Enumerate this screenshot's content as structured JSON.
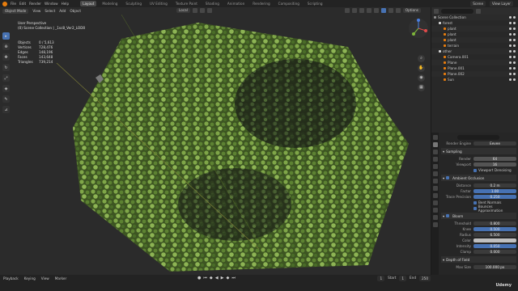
{
  "menu": [
    "File",
    "Edit",
    "Render",
    "Window",
    "Help"
  ],
  "workspaces": [
    "Layout",
    "Modeling",
    "Sculpting",
    "UV Editing",
    "Texture Paint",
    "Shading",
    "Animation",
    "Rendering",
    "Compositing",
    "Scripting"
  ],
  "active_workspace": "Layout",
  "scene_name": "Scene",
  "view_layer": "View Layer",
  "header": {
    "mode": "Object Mode",
    "menus": [
      "View",
      "Select",
      "Add",
      "Object"
    ],
    "orientation": "Local",
    "options": "Options"
  },
  "viewport": {
    "title": "User Perspective",
    "collection": "(0) Scene Collection | _1sc8_Ver2_LOD0",
    "stats": [
      {
        "k": "Objects",
        "v": "0 / 5,613"
      },
      {
        "k": "Vertices",
        "v": "728,476"
      },
      {
        "k": "Edges",
        "v": "148,196"
      },
      {
        "k": "Faces",
        "v": "143,648"
      },
      {
        "k": "Triangles",
        "v": "739,214"
      }
    ]
  },
  "outliner": {
    "title": "Scene Collection",
    "rows": [
      {
        "name": "Scene Collection",
        "indent": 0,
        "color": "#8f8f8f"
      },
      {
        "name": "forest",
        "indent": 1,
        "color": "#d4d4d4"
      },
      {
        "name": "plant",
        "indent": 2,
        "color": "#e87d0d"
      },
      {
        "name": "plant",
        "indent": 2,
        "color": "#e87d0d"
      },
      {
        "name": "plant",
        "indent": 2,
        "color": "#e87d0d"
      },
      {
        "name": "terrain",
        "indent": 2,
        "color": "#e87d0d"
      },
      {
        "name": "other",
        "indent": 1,
        "color": "#d4d4d4"
      },
      {
        "name": "Camera.001",
        "indent": 2,
        "color": "#e87d0d"
      },
      {
        "name": "Plane",
        "indent": 2,
        "color": "#e87d0d"
      },
      {
        "name": "Plane.001",
        "indent": 2,
        "color": "#e87d0d"
      },
      {
        "name": "Plane.002",
        "indent": 2,
        "color": "#e87d0d"
      },
      {
        "name": "Sun",
        "indent": 2,
        "color": "#e87d0d"
      }
    ]
  },
  "properties": {
    "render_engine_label": "Render Engine",
    "render_engine": "Eevee",
    "sampling": {
      "title": "Sampling",
      "render_label": "Render",
      "render": "64",
      "viewport_label": "Viewport",
      "viewport": "16",
      "denoise": "Viewport Denoising"
    },
    "ao": {
      "title": "Ambient Occlusion",
      "distance_label": "Distance",
      "distance": "0.2 m",
      "factor_label": "Factor",
      "factor": "1.00",
      "trace_label": "Trace Precision",
      "trace": "0.250",
      "bent": "Bent Normals",
      "bounce": "Bounces Approximation"
    },
    "bloom": {
      "title": "Bloom",
      "threshold_label": "Threshold",
      "threshold": "0.800",
      "knee_label": "Knee",
      "knee": "0.500",
      "radius_label": "Radius",
      "radius": "6.500",
      "color_label": "Color",
      "intensity_label": "Intensity",
      "intensity": "0.050",
      "clamp_label": "Clamp",
      "clamp": "0.000"
    },
    "dof": {
      "title": "Depth of Field",
      "max_label": "Max Size",
      "max": "100.000 px"
    }
  },
  "timeline": {
    "items": [
      "Playback",
      "Keying",
      "View",
      "Marker"
    ],
    "start_label": "Start",
    "start": "1",
    "end_label": "End",
    "end": "250",
    "frame": "1"
  },
  "watermark": "Udemy",
  "colors": {
    "accent_blue": "#4772b3",
    "blender_orange": "#e87d0d",
    "foliage": "#6b8f3a"
  }
}
